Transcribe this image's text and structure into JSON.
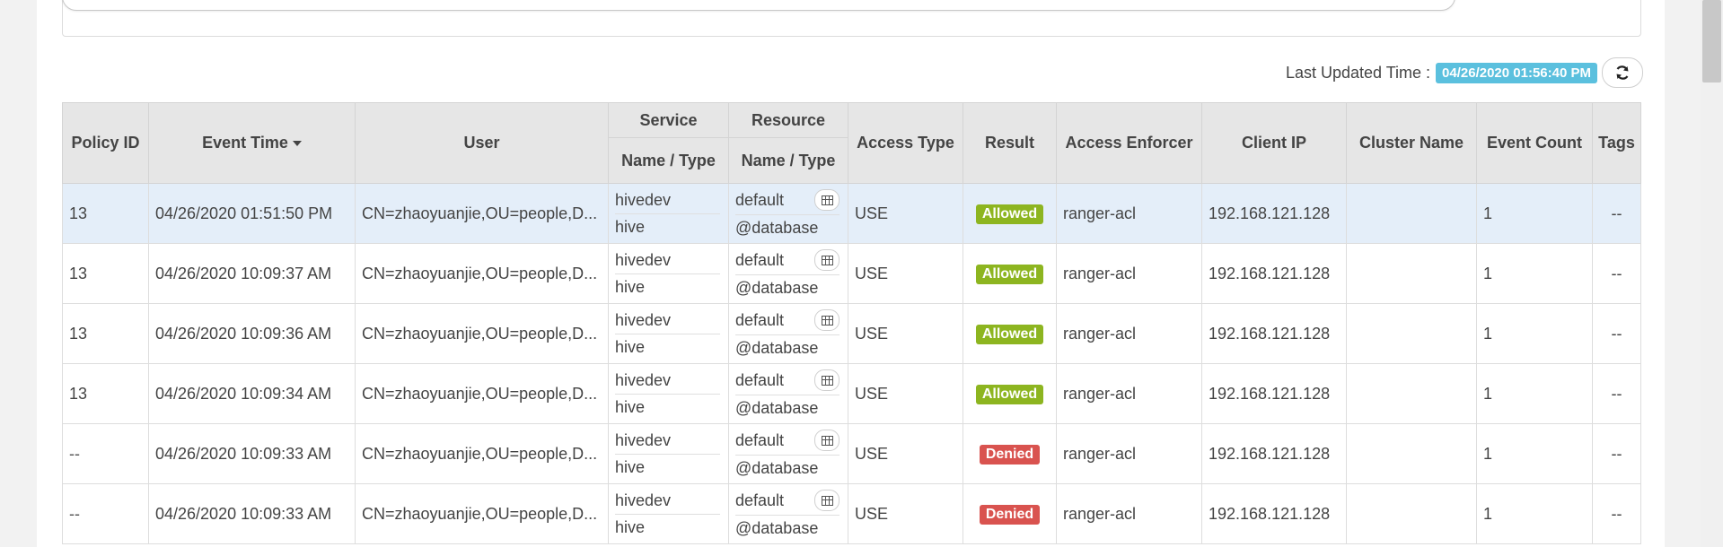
{
  "header": {
    "last_updated_label": "Last Updated Time :",
    "last_updated_value": "04/26/2020 01:56:40 PM",
    "refresh_icon": "refresh-icon"
  },
  "table": {
    "group_headers": {
      "service": "Service",
      "resource": "Resource"
    },
    "columns": {
      "policy_id": "Policy ID",
      "event_time": "Event Time",
      "user": "User",
      "service_name_type": "Name / Type",
      "resource_name_type": "Name / Type",
      "access_type": "Access Type",
      "result": "Result",
      "access_enforcer": "Access Enforcer",
      "client_ip": "Client IP",
      "cluster_name": "Cluster Name",
      "event_count": "Event Count",
      "tags": "Tags"
    },
    "rows": [
      {
        "policy_id": "13",
        "event_time": "04/26/2020 01:51:50 PM",
        "user": "CN=zhaoyuanjie,OU=people,D...",
        "service_name": "hivedev",
        "service_type": "hive",
        "resource_name": "default",
        "resource_type": "@database",
        "access_type": "USE",
        "result": "Allowed",
        "access_enforcer": "ranger-acl",
        "client_ip": "192.168.121.128",
        "cluster_name": "",
        "event_count": "1",
        "tags": "--"
      },
      {
        "policy_id": "13",
        "event_time": "04/26/2020 10:09:37 AM",
        "user": "CN=zhaoyuanjie,OU=people,D...",
        "service_name": "hivedev",
        "service_type": "hive",
        "resource_name": "default",
        "resource_type": "@database",
        "access_type": "USE",
        "result": "Allowed",
        "access_enforcer": "ranger-acl",
        "client_ip": "192.168.121.128",
        "cluster_name": "",
        "event_count": "1",
        "tags": "--"
      },
      {
        "policy_id": "13",
        "event_time": "04/26/2020 10:09:36 AM",
        "user": "CN=zhaoyuanjie,OU=people,D...",
        "service_name": "hivedev",
        "service_type": "hive",
        "resource_name": "default",
        "resource_type": "@database",
        "access_type": "USE",
        "result": "Allowed",
        "access_enforcer": "ranger-acl",
        "client_ip": "192.168.121.128",
        "cluster_name": "",
        "event_count": "1",
        "tags": "--"
      },
      {
        "policy_id": "13",
        "event_time": "04/26/2020 10:09:34 AM",
        "user": "CN=zhaoyuanjie,OU=people,D...",
        "service_name": "hivedev",
        "service_type": "hive",
        "resource_name": "default",
        "resource_type": "@database",
        "access_type": "USE",
        "result": "Allowed",
        "access_enforcer": "ranger-acl",
        "client_ip": "192.168.121.128",
        "cluster_name": "",
        "event_count": "1",
        "tags": "--"
      },
      {
        "policy_id": "--",
        "event_time": "04/26/2020 10:09:33 AM",
        "user": "CN=zhaoyuanjie,OU=people,D...",
        "service_name": "hivedev",
        "service_type": "hive",
        "resource_name": "default",
        "resource_type": "@database",
        "access_type": "USE",
        "result": "Denied",
        "access_enforcer": "ranger-acl",
        "client_ip": "192.168.121.128",
        "cluster_name": "",
        "event_count": "1",
        "tags": "--"
      },
      {
        "policy_id": "--",
        "event_time": "04/26/2020 10:09:33 AM",
        "user": "CN=zhaoyuanjie,OU=people,D...",
        "service_name": "hivedev",
        "service_type": "hive",
        "resource_name": "default",
        "resource_type": "@database",
        "access_type": "USE",
        "result": "Denied",
        "access_enforcer": "ranger-acl",
        "client_ip": "192.168.121.128",
        "cluster_name": "",
        "event_count": "1",
        "tags": "--"
      }
    ]
  },
  "colors": {
    "allowed": "#8db520",
    "denied": "#d9534f",
    "badge": "#5bc0de",
    "policy_link": "#5a8f0c"
  }
}
